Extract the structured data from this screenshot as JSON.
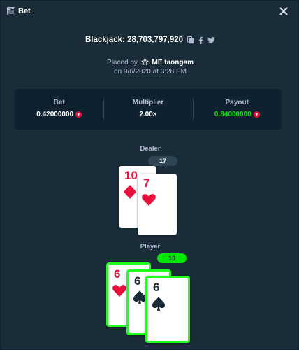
{
  "header": {
    "title": "Bet",
    "icon": "receipt-icon"
  },
  "bet_info": {
    "game_id": "Blackjack: 28,703,797,920",
    "placed_by_prefix": "Placed by",
    "user": "ME taongam",
    "date_line": "on 9/6/2020 at 3:28 PM"
  },
  "stats": {
    "bet_label": "Bet",
    "bet_value": "0.42000000",
    "multiplier_label": "Multiplier",
    "multiplier_value": "2.00×",
    "payout_label": "Payout",
    "payout_value": "0.84000000"
  },
  "dealer": {
    "label": "Dealer",
    "score": "17",
    "cards": [
      {
        "rank": "10",
        "suit": "diamonds",
        "color": "red"
      },
      {
        "rank": "7",
        "suit": "hearts",
        "color": "red"
      }
    ]
  },
  "player": {
    "label": "Player",
    "score": "18",
    "cards": [
      {
        "rank": "6",
        "suit": "hearts",
        "color": "red"
      },
      {
        "rank": "6",
        "suit": "spades",
        "color": "black"
      },
      {
        "rank": "6",
        "suit": "spades",
        "color": "black"
      }
    ]
  },
  "colors": {
    "background": "#1a2c38",
    "panel": "#0f212e",
    "accent_green": "#00e701",
    "card_red": "#e9113c",
    "coin_red": "#e9113c"
  }
}
